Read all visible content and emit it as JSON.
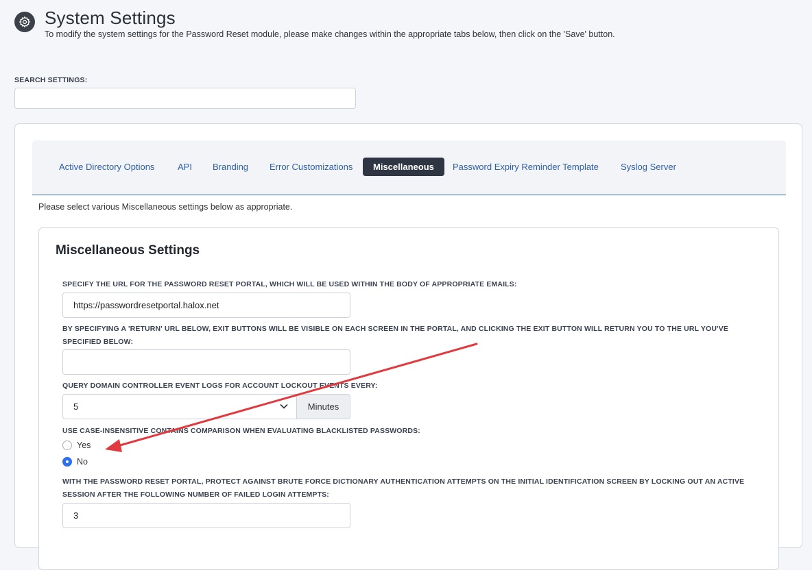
{
  "header": {
    "title": "System Settings",
    "subtitle": "To modify the system settings for the Password Reset module, please make changes within the appropriate tabs below, then click on the 'Save' button.",
    "icon": "gear-icon"
  },
  "search": {
    "label": "SEARCH SETTINGS:",
    "value": "",
    "placeholder": ""
  },
  "tabs": [
    {
      "label": "Active Directory Options",
      "active": false
    },
    {
      "label": "API",
      "active": false
    },
    {
      "label": "Branding",
      "active": false
    },
    {
      "label": "Error Customizations",
      "active": false
    },
    {
      "label": "Miscellaneous",
      "active": true
    },
    {
      "label": "Password Expiry Reminder Template",
      "active": false
    },
    {
      "label": "Syslog Server",
      "active": false
    }
  ],
  "intro": "Please select various Miscellaneous settings below as appropriate.",
  "section": {
    "title": "Miscellaneous Settings",
    "fields": {
      "portal_url": {
        "label": "SPECIFY THE URL FOR THE PASSWORD RESET PORTAL, WHICH WILL BE USED WITHIN THE BODY OF APPROPRIATE EMAILS:",
        "value": "https://passwordresetportal.halox.net"
      },
      "return_url": {
        "label": "BY SPECIFYING A 'RETURN' URL BELOW, EXIT BUTTONS WILL BE VISIBLE ON EACH SCREEN IN THE PORTAL, AND CLICKING THE EXIT BUTTON WILL RETURN YOU TO THE URL YOU'VE SPECIFIED BELOW:",
        "value": ""
      },
      "query_interval": {
        "label": "QUERY DOMAIN CONTROLLER EVENT LOGS FOR ACCOUNT LOCKOUT EVENTS EVERY:",
        "value": "5",
        "unit": "Minutes"
      },
      "case_insensitive": {
        "label": "USE CASE-INSENSITIVE CONTAINS COMPARISON WHEN EVALUATING BLACKLISTED PASSWORDS:",
        "options": [
          {
            "label": "Yes",
            "checked": false
          },
          {
            "label": "No",
            "checked": true
          }
        ]
      },
      "brute_force": {
        "label": "WITH THE PASSWORD RESET PORTAL, PROTECT AGAINST BRUTE FORCE DICTIONARY AUTHENTICATION ATTEMPTS ON THE INITIAL IDENTIFICATION SCREEN BY LOCKING OUT AN ACTIVE SESSION AFTER THE FOLLOWING NUMBER OF FAILED LOGIN ATTEMPTS:",
        "value": "3"
      }
    }
  },
  "colors": {
    "accent": "#2d5fa8",
    "active_tab_bg": "#2f3542",
    "radio_checked": "#2d6ff0",
    "annotation_arrow": "#e0393e"
  }
}
